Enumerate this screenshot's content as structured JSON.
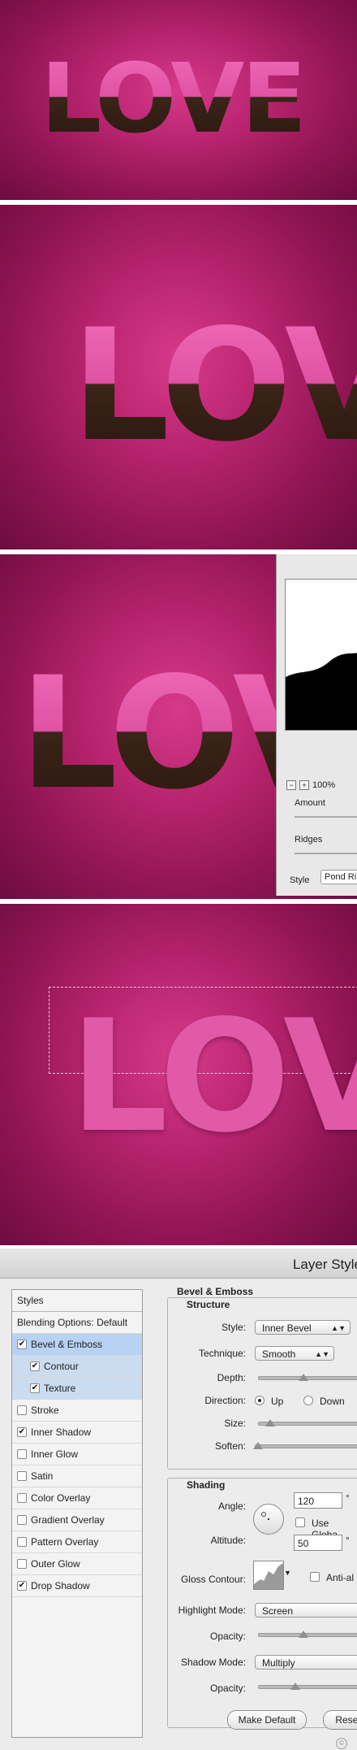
{
  "panel1": {
    "word": "LOVE"
  },
  "panel2": {
    "word": "LOVE"
  },
  "panel3": {
    "word": "LOVE",
    "curves": {
      "zoom_value": "100%",
      "zoom_minus": "−",
      "zoom_plus": "+",
      "amount_label": "Amount",
      "ridges_label": "Ridges",
      "style_label": "Style",
      "style_value": "Pond Ri"
    }
  },
  "panel4": {
    "word": "LOVE"
  },
  "layer_style": {
    "title": "Layer Style",
    "styles_header": "Styles",
    "items": [
      {
        "label": "Blending Options: Default",
        "checked": null,
        "state": "normal",
        "indent": 0
      },
      {
        "label": "Bevel & Emboss",
        "checked": true,
        "state": "selected",
        "indent": 0
      },
      {
        "label": "Contour",
        "checked": true,
        "state": "sub",
        "indent": 1
      },
      {
        "label": "Texture",
        "checked": true,
        "state": "sub",
        "indent": 1
      },
      {
        "label": "Stroke",
        "checked": false,
        "state": "normal",
        "indent": 0
      },
      {
        "label": "Inner Shadow",
        "checked": true,
        "state": "normal",
        "indent": 0
      },
      {
        "label": "Inner Glow",
        "checked": false,
        "state": "normal",
        "indent": 0
      },
      {
        "label": "Satin",
        "checked": false,
        "state": "normal",
        "indent": 0
      },
      {
        "label": "Color Overlay",
        "checked": false,
        "state": "normal",
        "indent": 0
      },
      {
        "label": "Gradient Overlay",
        "checked": false,
        "state": "normal",
        "indent": 0
      },
      {
        "label": "Pattern Overlay",
        "checked": false,
        "state": "normal",
        "indent": 0
      },
      {
        "label": "Outer Glow",
        "checked": false,
        "state": "normal",
        "indent": 0
      },
      {
        "label": "Drop Shadow",
        "checked": true,
        "state": "normal",
        "indent": 0
      }
    ],
    "bevel_title": "Bevel & Emboss",
    "structure_title": "Structure",
    "style_label": "Style:",
    "style_value": "Inner Bevel",
    "technique_label": "Technique:",
    "technique_value": "Smooth",
    "depth_label": "Depth:",
    "direction_label": "Direction:",
    "direction_up": "Up",
    "direction_down": "Down",
    "size_label": "Size:",
    "soften_label": "Soften:",
    "shading_title": "Shading",
    "angle_label": "Angle:",
    "angle_value": "120",
    "degree_symbol": "°",
    "use_global_label": "Use Globa",
    "altitude_label": "Altitude:",
    "altitude_value": "50",
    "gloss_contour_label": "Gloss Contour:",
    "antialias_label": "Anti-al",
    "highlight_mode_label": "Highlight Mode:",
    "highlight_mode_value": "Screen",
    "opacity_label": "Opacity:",
    "shadow_mode_label": "Shadow Mode:",
    "shadow_mode_value": "Multiply",
    "opacity2_label": "Opacity:",
    "make_default_label": "Make Default",
    "reset_label": "Reset"
  }
}
